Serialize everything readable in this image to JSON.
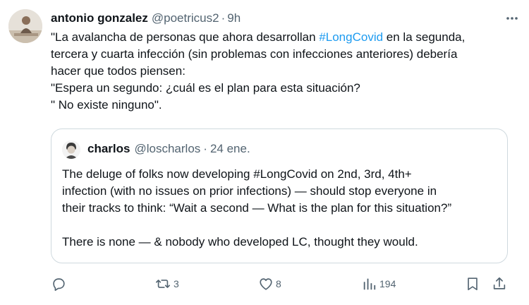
{
  "tweet": {
    "author_name": "antonio gonzalez",
    "author_handle": "@poetricus2",
    "separator": "·",
    "time": "9h",
    "more_icon": "more-horizontal-icon",
    "lines": [
      {
        "before": "\"La avalancha de personas que ahora desarrollan ",
        "hashtag": "#LongCovid",
        "after": " en la segunda,"
      },
      {
        "text": "tercera y cuarta infección (sin problemas con infecciones anteriores) debería"
      },
      {
        "text": "hacer que todos piensen:"
      },
      {
        "text": "\"Espera un segundo: ¿cuál es el plan para esta situación?"
      },
      {
        "text": "\" No existe ninguno\"."
      }
    ],
    "hashtag_color": "#1d9bf0"
  },
  "quote": {
    "author_name": "charlos",
    "author_handle": "@loscharlos",
    "separator": "·",
    "time": "24 ene.",
    "lines": [
      "The deluge of folks now developing #LongCovid on 2nd, 3rd, 4th+",
      "infection (with no issues on prior infections) — should stop everyone in",
      "their tracks to think: “Wait a second — What is the plan for this situation?”",
      "There is none — & nobody who developed LC, thought they would."
    ]
  },
  "actions": {
    "reply": {
      "icon": "reply-icon",
      "count": ""
    },
    "retweet": {
      "icon": "retweet-icon",
      "count": "3"
    },
    "like": {
      "icon": "heart-icon",
      "count": "8"
    },
    "views": {
      "icon": "views-icon",
      "count": "194"
    },
    "bookmark": {
      "icon": "bookmark-icon"
    },
    "share": {
      "icon": "share-icon"
    }
  },
  "colors": {
    "text": "#0f1419",
    "secondary": "#536471",
    "border": "#cfd9de",
    "link": "#1d9bf0"
  }
}
